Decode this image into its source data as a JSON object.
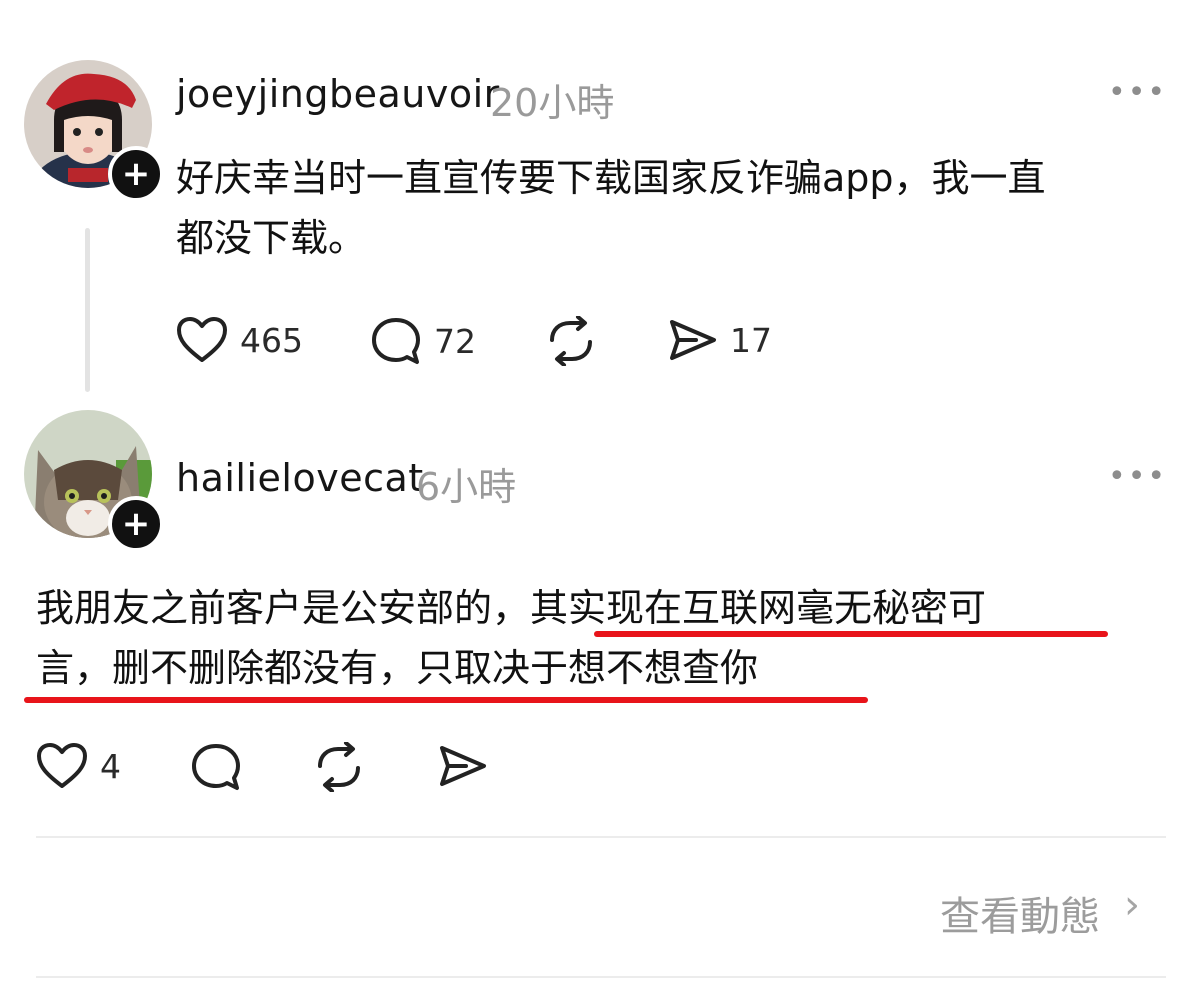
{
  "posts": [
    {
      "username": "joeyjingbeauvoir",
      "time": "20小時",
      "more_label": "•••",
      "text_lines": [
        "好庆幸当时一直宣传要下载国家反诈骗app，我一直",
        "都没下载。"
      ],
      "actions": {
        "like_count": "465",
        "reply_count": "72",
        "repost_count": "",
        "share_count": "17"
      }
    },
    {
      "username": "hailielovecat",
      "time": "6小時",
      "more_label": "•••",
      "text_lines": [
        "我朋友之前客户是公安部的，其实现在互联网毫无秘密可",
        "言，删不删除都没有，只取决于想不想查你"
      ],
      "actions": {
        "like_count": "4",
        "reply_count": "",
        "repost_count": "",
        "share_count": ""
      }
    }
  ],
  "footer": {
    "view_activity": "查看動態",
    "chevron": "›"
  },
  "follow_badge": "+",
  "colors": {
    "underline": "#e8141a",
    "muted": "#9a9a9a"
  },
  "icons": [
    "heart-icon",
    "comment-icon",
    "repost-icon",
    "share-icon",
    "plus-icon",
    "more-icon",
    "chevron-right-icon"
  ]
}
